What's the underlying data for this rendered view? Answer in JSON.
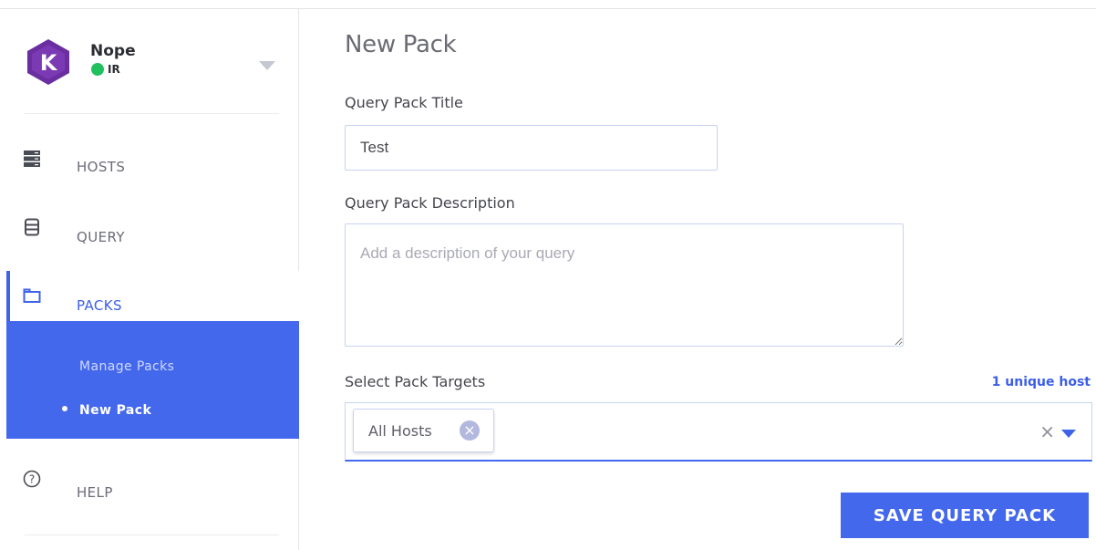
{
  "user": {
    "name": "Nope",
    "team": "IR",
    "logo_letter": "K",
    "status_color": "#21c05e"
  },
  "nav": {
    "items": [
      {
        "label": "HOSTS",
        "icon": "server-icon"
      },
      {
        "label": "QUERY",
        "icon": "database-icon"
      },
      {
        "label": "PACKS",
        "icon": "folder-icon"
      },
      {
        "label": "HELP",
        "icon": "question-circle-icon"
      }
    ],
    "packs_sub": [
      {
        "label": "Manage Packs"
      },
      {
        "label": "New Pack"
      }
    ]
  },
  "main": {
    "title": "New Pack",
    "title_label": "Query Pack Title",
    "title_value": "Test",
    "description_label": "Query Pack Description",
    "description_placeholder": "Add a description of your query",
    "targets_label": "Select Pack Targets",
    "targets_count": "1 unique host",
    "targets": [
      {
        "label": "All Hosts"
      }
    ],
    "save_label": "SAVE QUERY PACK"
  },
  "colors": {
    "accent": "#4468ec",
    "logo": "#6a2ea0"
  }
}
